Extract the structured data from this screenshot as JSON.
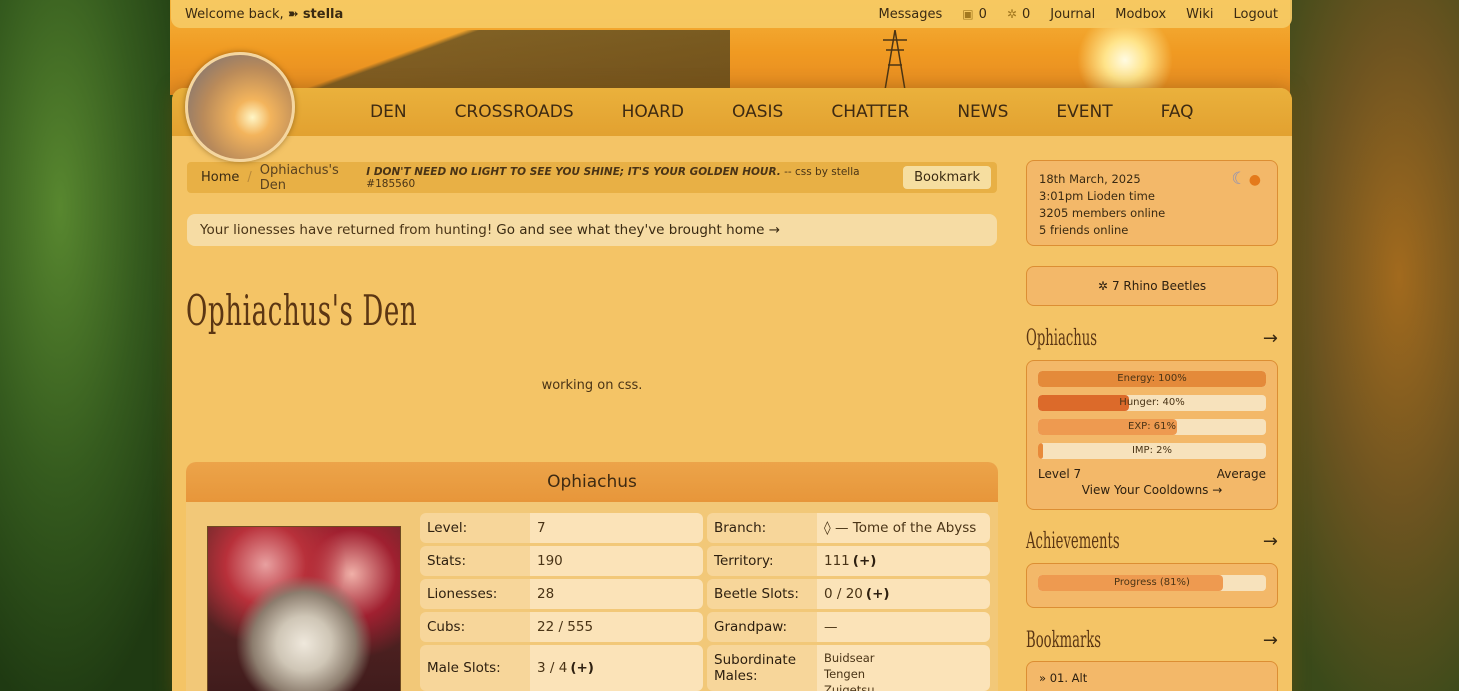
{
  "topbar": {
    "welcome_prefix": "Welcome back,",
    "username_icon": "➽",
    "username": "stella",
    "messages": "Messages",
    "count_a": "0",
    "count_b": "0",
    "journal": "Journal",
    "modbox": "Modbox",
    "wiki": "Wiki",
    "logout": "Logout"
  },
  "nav": {
    "items": [
      "DEN",
      "CROSSROADS",
      "HOARD",
      "OASIS",
      "CHATTER",
      "NEWS",
      "EVENT",
      "FAQ"
    ]
  },
  "breadcrumb": {
    "home": "Home",
    "separator": "/",
    "current": "Ophiachus's Den",
    "tagline_quote": "I DON'T NEED NO LIGHT TO SEE YOU SHINE; IT'S YOUR GOLDEN HOUR.",
    "tagline_credit": "-- css by stella #185560",
    "bookmark": "Bookmark"
  },
  "notice": {
    "text": "Your lionesses have returned from hunting!",
    "link": "Go and see what they've brought home →"
  },
  "den": {
    "title": "Ophiachus's Den",
    "description": "working on css."
  },
  "lion": {
    "name": "Ophiachus",
    "stats_left": [
      {
        "key": "Level:",
        "value": "7",
        "extra": ""
      },
      {
        "key": "Stats:",
        "value": "190",
        "extra": ""
      },
      {
        "key": "Lionesses:",
        "value": "28",
        "extra": ""
      },
      {
        "key": "Cubs:",
        "value": "22 / 555",
        "extra": ""
      },
      {
        "key": "Male Slots:",
        "value": "3 / 4",
        "extra": "(+)"
      }
    ],
    "stats_right": [
      {
        "key": "Branch:",
        "value": "◊ — Tome of the Abyss",
        "extra": ""
      },
      {
        "key": "Territory:",
        "value": "111",
        "extra": "(+)"
      },
      {
        "key": "Beetle Slots:",
        "value": "0 / 20",
        "extra": "(+)"
      },
      {
        "key": "Grandpaw:",
        "value": "—",
        "extra": ""
      }
    ],
    "subordinate_key": "Subordinate Males:",
    "subordinates": [
      "Buidsear",
      "Tengen",
      "Zuigetsu"
    ]
  },
  "sidebar": {
    "date": "18th March, 2025",
    "time": "3:01pm Lioden time",
    "members": "3205 members online",
    "friends": "5 friends online",
    "beetles": "7 Rhino Beetles",
    "ophi_heading": "Ophiachus",
    "bars": [
      {
        "label": "Energy: 100%",
        "value": 1.0,
        "color": "#e48a3a"
      },
      {
        "label": "Hunger: 40%",
        "value": 0.4,
        "color": "#dc6a2a"
      },
      {
        "label": "EXP: 61%",
        "value": 0.61,
        "color": "#ee9a50"
      },
      {
        "label": "IMP: 2%",
        "value": 0.02,
        "color": "#e88a3a"
      }
    ],
    "level": "Level 7",
    "average": "Average",
    "cooldowns": "View Your Cooldowns →",
    "ach_heading": "Achievements",
    "progress_label": "Progress (81%)",
    "progress_value": 0.81,
    "bm_heading": "Bookmarks",
    "bm_item": "» 01. Alt",
    "arrow": "→"
  }
}
